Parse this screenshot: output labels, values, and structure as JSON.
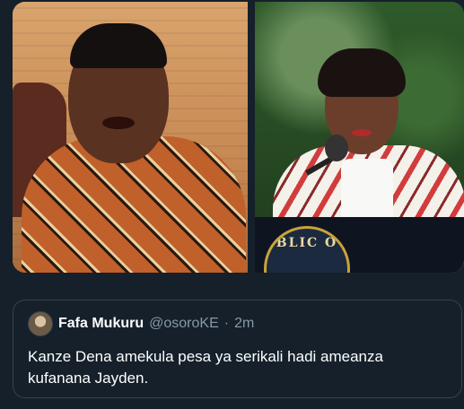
{
  "media": {
    "left_image": {
      "description_icon": "photo-man-in-patterned-shirt"
    },
    "right_image": {
      "description_icon": "photo-woman-at-podium",
      "seal_text": "BLIC O"
    }
  },
  "quoted_tweet": {
    "display_name": "Fafa Mukuru",
    "handle": "@osoroKE",
    "separator": "·",
    "time": "2m",
    "text": "Kanze Dena amekula pesa ya serikali hadi ameanza\nkufanana Jayden."
  },
  "colors": {
    "background": "#15202b",
    "card_border": "#38444d",
    "secondary_text": "#8899a6",
    "primary_text": "#ffffff"
  }
}
